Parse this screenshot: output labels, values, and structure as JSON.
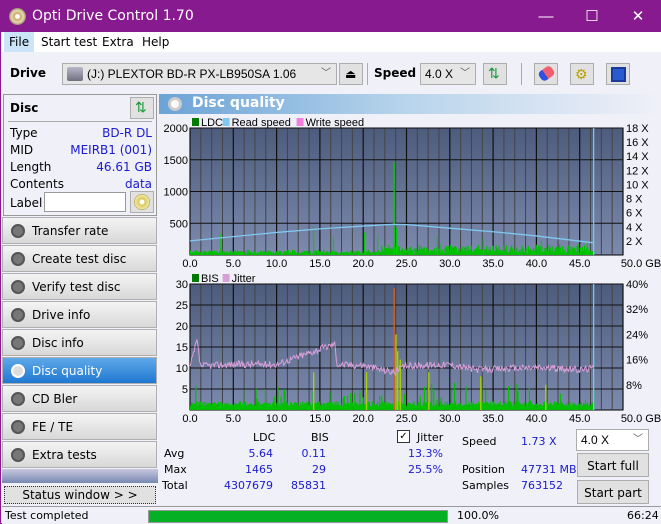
{
  "window": {
    "title": "Opti Drive Control 1.70",
    "minimize": "—",
    "maximize": "☐",
    "close": "✕"
  },
  "menu": [
    {
      "label": "File",
      "active": true
    },
    {
      "label": "Start test",
      "active": false
    },
    {
      "label": "Extra",
      "active": false
    },
    {
      "label": "Help",
      "active": false
    }
  ],
  "toolbar": {
    "drive_label": "Drive",
    "drive_value": "(J:)  PLEXTOR BD-R  PX-LB950SA 1.06",
    "speed_label": "Speed",
    "speed_value": "4.0 X"
  },
  "disc": {
    "header": "Disc",
    "type_label": "Type",
    "type_value": "BD-R DL",
    "mid_label": "MID",
    "mid_value": "MEIRB1 (001)",
    "length_label": "Length",
    "length_value": "46.61 GB",
    "contents_label": "Contents",
    "contents_value": "data",
    "label_label": "Label",
    "label_value": ""
  },
  "nav": [
    {
      "label": "Transfer rate",
      "active": false
    },
    {
      "label": "Create test disc",
      "active": false
    },
    {
      "label": "Verify test disc",
      "active": false
    },
    {
      "label": "Drive info",
      "active": false
    },
    {
      "label": "Disc info",
      "active": false
    },
    {
      "label": "Disc quality",
      "active": true
    },
    {
      "label": "CD Bler",
      "active": false
    },
    {
      "label": "FE / TE",
      "active": false
    },
    {
      "label": "Extra tests",
      "active": false
    }
  ],
  "status_window_label": "Status window > >",
  "panel": {
    "title": "Disc quality"
  },
  "chart_data": [
    {
      "type": "bar",
      "title": "LDC",
      "legend": [
        {
          "name": "LDC",
          "color": "#007a00"
        },
        {
          "name": "Read speed",
          "color": "#80c8f0"
        },
        {
          "name": "Write speed",
          "color": "#f080e0"
        }
      ],
      "xlabel": "GB",
      "xlim": [
        0,
        50
      ],
      "x_ticks": [
        "0.0",
        "5.0",
        "10.0",
        "15.0",
        "20.0",
        "25.0",
        "30.0",
        "35.0",
        "40.0",
        "45.0",
        "50.0 GB"
      ],
      "ylim": [
        0,
        2000
      ],
      "y_ticks": [
        "2000",
        "1500",
        "1000",
        "500"
      ],
      "y2lim": [
        0,
        18
      ],
      "y2_ticks": [
        "18 X",
        "16 X",
        "14 X",
        "12 X",
        "10 X",
        "8 X",
        "6 X",
        "4 X",
        "2 X"
      ],
      "disc_end_gb": 46.61,
      "ldc_spikes": [
        [
          3.5,
          330
        ],
        [
          14.2,
          450
        ],
        [
          23.5,
          1465
        ],
        [
          23.8,
          420
        ],
        [
          16.5,
          280
        ],
        [
          20.1,
          350
        ],
        [
          21.6,
          310
        ],
        [
          28.5,
          300
        ],
        [
          33.8,
          270
        ],
        [
          40.5,
          220
        ],
        [
          45.8,
          200
        ]
      ],
      "ldc_baseline": 40,
      "read_speed": [
        [
          0,
          2.0
        ],
        [
          5,
          2.6
        ],
        [
          10,
          3.2
        ],
        [
          15,
          3.7
        ],
        [
          20,
          4.1
        ],
        [
          23.5,
          4.35
        ],
        [
          25,
          4.3
        ],
        [
          30,
          3.8
        ],
        [
          35,
          3.3
        ],
        [
          40,
          2.7
        ],
        [
          46.6,
          1.73
        ]
      ]
    },
    {
      "type": "bar",
      "title": "BIS",
      "legend": [
        {
          "name": "BIS",
          "color": "#007a00"
        },
        {
          "name": "Jitter",
          "color": "#d8a0d8"
        }
      ],
      "xlabel": "GB",
      "xlim": [
        0,
        50
      ],
      "x_ticks": [
        "0.0",
        "5.0",
        "10.0",
        "15.0",
        "20.0",
        "25.0",
        "30.0",
        "35.0",
        "40.0",
        "45.0",
        "50.0 GB"
      ],
      "ylim": [
        0,
        30
      ],
      "y_ticks": [
        "30",
        "25",
        "20",
        "15",
        "10",
        "5"
      ],
      "y2lim": [
        0,
        40
      ],
      "y2_ticks": [
        "40%",
        "32%",
        "24%",
        "16%",
        "8%"
      ],
      "disc_end_gb": 46.61,
      "bis_spikes": [
        [
          23.5,
          29
        ],
        [
          23.7,
          18
        ],
        [
          23.9,
          14
        ],
        [
          24.2,
          12
        ],
        [
          14.2,
          9
        ],
        [
          20.3,
          9
        ],
        [
          27.5,
          9
        ],
        [
          33.5,
          8
        ],
        [
          41.0,
          6
        ]
      ],
      "bis_baseline": 1.5,
      "jitter_pct": [
        [
          0,
          13.5
        ],
        [
          0.8,
          22
        ],
        [
          1.2,
          14
        ],
        [
          5,
          14.5
        ],
        [
          10,
          14.5
        ],
        [
          16.7,
          21
        ],
        [
          17,
          14.5
        ],
        [
          20,
          14.2
        ],
        [
          23.5,
          12
        ],
        [
          25,
          14
        ],
        [
          30,
          14.5
        ],
        [
          33,
          12.8
        ],
        [
          35,
          13
        ],
        [
          40,
          13.5
        ],
        [
          45,
          12.8
        ],
        [
          46.6,
          13.3
        ]
      ]
    }
  ],
  "stats": {
    "col_ldc": "LDC",
    "col_bis": "BIS",
    "jitter_label": "Jitter",
    "jitter_checked": true,
    "avg_label": "Avg",
    "avg_ldc": "5.64",
    "avg_bis": "0.11",
    "avg_jitter": "13.3%",
    "max_label": "Max",
    "max_ldc": "1465",
    "max_bis": "29",
    "max_jitter": "25.5%",
    "total_label": "Total",
    "total_ldc": "4307679",
    "total_bis": "85831",
    "speed_label": "Speed",
    "speed_value": "1.73 X",
    "position_label": "Position",
    "position_value": "47731 MB",
    "samples_label": "Samples",
    "samples_value": "763152",
    "speed_select": "4.0 X",
    "start_full": "Start full",
    "start_part": "Start part"
  },
  "statusbar": {
    "text": "Test completed",
    "progress_pct": 100,
    "progress_label": "100.0%",
    "elapsed": "66:24"
  }
}
